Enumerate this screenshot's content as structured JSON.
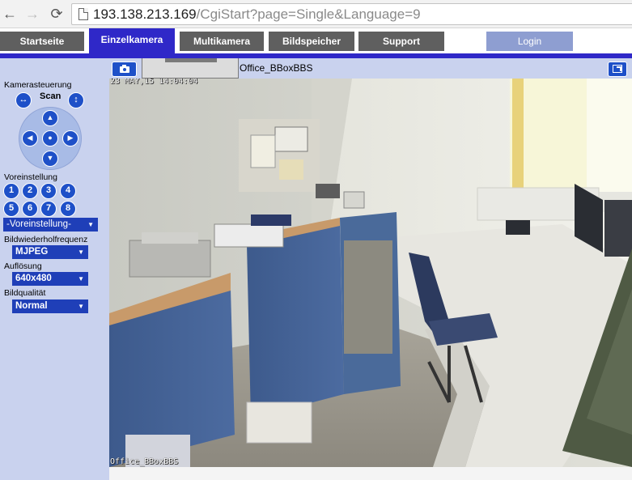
{
  "browser": {
    "url_host": "193.138.213.169",
    "url_path": "/CgiStart?page=Single&Language=9",
    "back_icon": "arrow-left-icon",
    "forward_icon": "arrow-right-icon",
    "reload_icon": "reload-icon"
  },
  "menu": {
    "tabs": [
      {
        "label": "Startseite"
      },
      {
        "label": "Einzelkamera",
        "active": true
      },
      {
        "label": "Multikamera"
      },
      {
        "label": "Bildspeicher"
      },
      {
        "label": "Support"
      }
    ],
    "login_label": "Login"
  },
  "sidebar": {
    "camera_control_label": "Kamerasteuerung",
    "scan_label": "Scan",
    "preset_label": "Voreinstellung",
    "presets": [
      "1",
      "2",
      "3",
      "4",
      "5",
      "6",
      "7",
      "8"
    ],
    "preset_select": "-Voreinstellung-",
    "refresh_label": "Bildwiederholfrequenz",
    "refresh_select": "MJPEG",
    "resolution_label": "Auflösung",
    "resolution_select": "640x480",
    "quality_label": "Bildqualität",
    "quality_select": "Normal"
  },
  "camera": {
    "name": "Office_BBoxBBS",
    "timestamp_overlay": "23 MAY,15 14:04:04",
    "name_overlay": "Office_BBoxBBS"
  },
  "colors": {
    "accent_blue": "#2f28c8",
    "sidebar_bg": "#c9d2ee",
    "tab_gray": "#5f5f5f",
    "login_tab": "#8e9ed1",
    "button_blue": "#1e50c8"
  }
}
